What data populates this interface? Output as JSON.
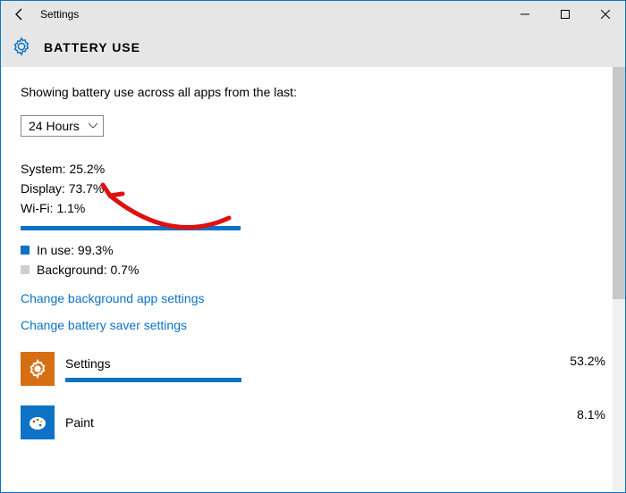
{
  "window": {
    "title": "Settings"
  },
  "page": {
    "heading": "BATTERY USE"
  },
  "intro": "Showing battery use across all apps from the last:",
  "dropdown": {
    "selected": "24 Hours"
  },
  "stats": {
    "system_label": "System:",
    "system_value": "25.2%",
    "display_label": "Display:",
    "display_value": "73.7%",
    "wifi_label": "Wi-Fi:",
    "wifi_value": "1.1%"
  },
  "usage": {
    "in_use_label": "In use:",
    "in_use_value": "99.3%",
    "background_label": "Background:",
    "background_value": "0.7%"
  },
  "links": {
    "bg_apps": "Change background app settings",
    "battery_saver": "Change battery saver settings"
  },
  "apps": [
    {
      "name": "Settings",
      "pct": "53.2%",
      "bar_pct": 53.2
    },
    {
      "name": "Paint",
      "pct": "8.1%",
      "bar_pct": 8.1
    }
  ]
}
